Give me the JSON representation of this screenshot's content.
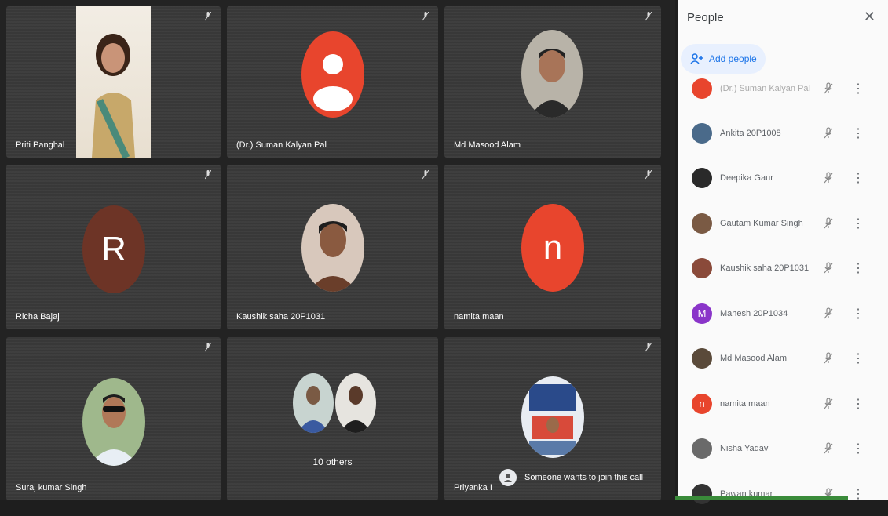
{
  "tiles": [
    {
      "name": "Priti Panghal"
    },
    {
      "name": "(Dr.) Suman Kalyan Pal"
    },
    {
      "name": "Md Masood Alam"
    },
    {
      "name": "Richa Bajaj",
      "letter": "R"
    },
    {
      "name": "Kaushik saha 20P1031"
    },
    {
      "name": "namita maan",
      "letter": "n"
    },
    {
      "name": "Suraj kumar Singh"
    },
    {
      "name": "10 others"
    },
    {
      "name": "Priyanka I"
    }
  ],
  "notification": {
    "text": "Someone wants to join this call"
  },
  "panel": {
    "title": "People",
    "add_label": "Add people",
    "people": [
      {
        "name": "(Dr.) Suman Kalyan Pal"
      },
      {
        "name": "Ankita 20P1008"
      },
      {
        "name": "Deepika Gaur"
      },
      {
        "name": "Gautam Kumar Singh"
      },
      {
        "name": "Kaushik saha 20P1031"
      },
      {
        "name": "Mahesh 20P1034",
        "letter": "M"
      },
      {
        "name": "Md Masood Alam"
      },
      {
        "name": "namita maan",
        "letter": "n"
      },
      {
        "name": "Nisha Yadav"
      },
      {
        "name": "Pawan kumar"
      }
    ]
  },
  "colors": {
    "accent": "#1a73e8",
    "richa_avatar": "#6d3426",
    "namita_avatar": "#e8452d",
    "suman_avatar": "#e8452d",
    "mahesh_avatar": "#8a35c9"
  }
}
